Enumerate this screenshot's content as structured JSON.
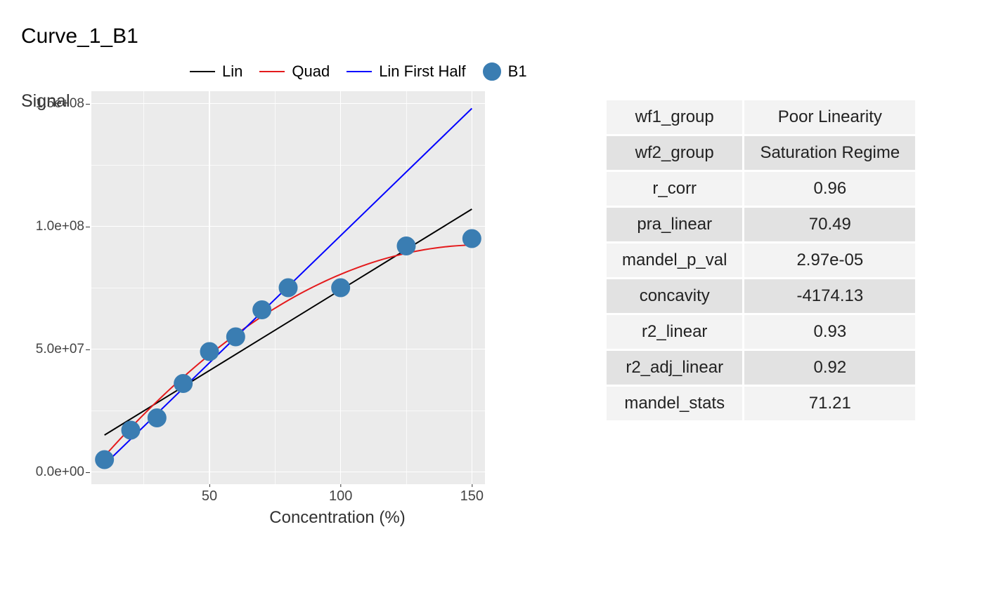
{
  "title": "Curve_1_B1",
  "legend": {
    "lin": "Lin",
    "quad": "Quad",
    "lin_first_half": "Lin First Half",
    "points": "B1"
  },
  "colors": {
    "lin": "#000000",
    "quad": "#e41a1c",
    "lin_first_half": "#0000ff",
    "point_fill": "#3a7db2",
    "point_stroke": "#3a7db2"
  },
  "axes": {
    "xlabel": "Concentration (%)",
    "ylabel": "Signal",
    "y_ticks_labels": [
      "0.0e+00",
      "5.0e+07",
      "1.0e+08",
      "1.5e+08"
    ],
    "x_ticks_labels": [
      "50",
      "100",
      "150"
    ]
  },
  "chart_data": {
    "type": "scatter",
    "title": "Curve_1_B1",
    "xlabel": "Concentration (%)",
    "ylabel": "Signal",
    "xlim": [
      5,
      155
    ],
    "ylim": [
      -5000000.0,
      155000000.0
    ],
    "x_ticks": [
      50,
      100,
      150
    ],
    "y_ticks": [
      0,
      50000000.0,
      100000000.0,
      150000000.0
    ],
    "series": [
      {
        "name": "B1",
        "type": "points",
        "x": [
          10,
          20,
          30,
          40,
          50,
          60,
          70,
          80,
          100,
          125,
          150
        ],
        "y": [
          5000000.0,
          17000000.0,
          22000000.0,
          36000000.0,
          49000000.0,
          55000000.0,
          66000000.0,
          75000000.0,
          75000000.0,
          92000000.0,
          95000000.0
        ]
      },
      {
        "name": "Lin",
        "type": "line",
        "x": [
          10,
          150
        ],
        "y": [
          15000000.0,
          107000000.0
        ]
      },
      {
        "name": "Quad",
        "type": "line",
        "a": -4174.13,
        "b": 1282000.0,
        "c": -6000000.0,
        "x_range": [
          10,
          150
        ]
      },
      {
        "name": "Lin First Half",
        "type": "line",
        "x": [
          10,
          150
        ],
        "y": [
          3000000.0,
          148000000.0
        ]
      }
    ]
  },
  "table": {
    "rows": [
      {
        "label": "wf1_group",
        "value": "Poor Linearity"
      },
      {
        "label": "wf2_group",
        "value": "Saturation Regime"
      },
      {
        "label": "r_corr",
        "value": "0.96"
      },
      {
        "label": "pra_linear",
        "value": "70.49"
      },
      {
        "label": "mandel_p_val",
        "value": "2.97e-05"
      },
      {
        "label": "concavity",
        "value": "-4174.13"
      },
      {
        "label": "r2_linear",
        "value": "0.93"
      },
      {
        "label": "r2_adj_linear",
        "value": "0.92"
      },
      {
        "label": "mandel_stats",
        "value": "71.21"
      }
    ]
  }
}
